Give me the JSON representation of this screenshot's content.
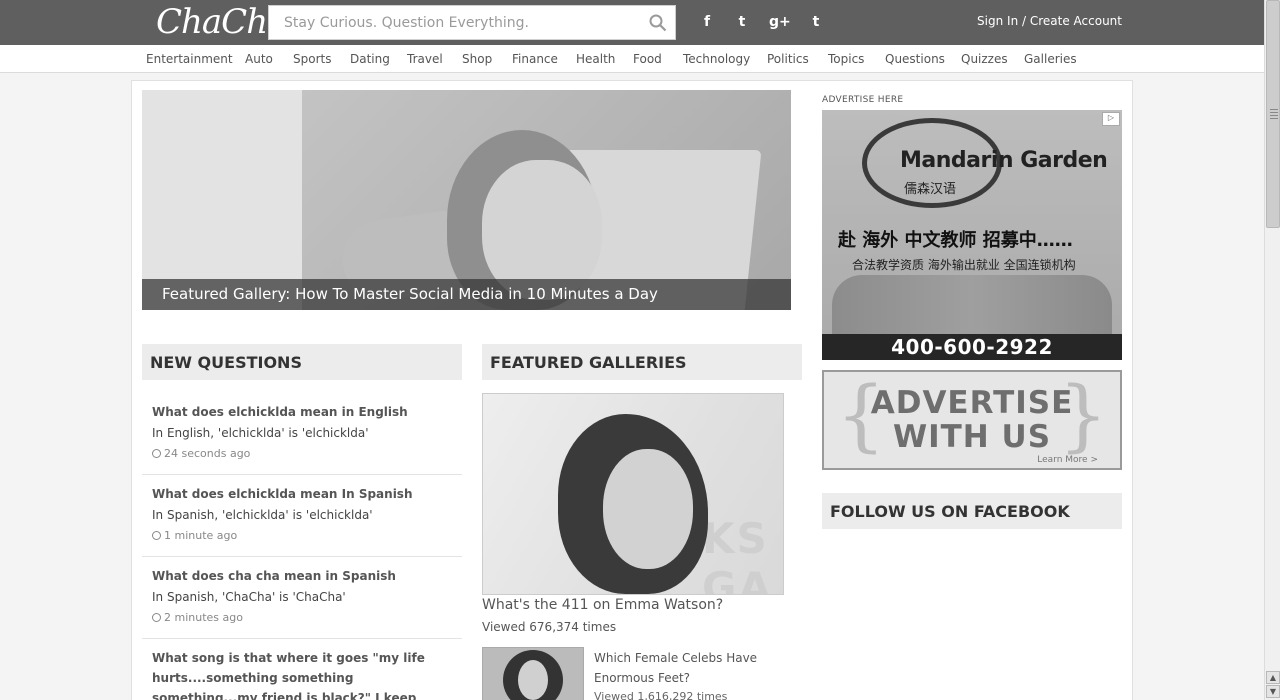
{
  "header": {
    "logo_text": "ChaCha",
    "search_placeholder": "Stay Curious. Question Everything.",
    "social_icons": [
      "facebook-icon",
      "twitter-icon",
      "google-plus-icon",
      "tumblr-icon"
    ],
    "social_glyphs": [
      "f",
      "t",
      "g+",
      "t"
    ],
    "signin_label": "Sign In / Create Account"
  },
  "nav": {
    "items": [
      "Entertainment",
      "Auto",
      "Sports",
      "Dating",
      "Travel",
      "Shop",
      "Finance",
      "Health",
      "Food",
      "Technology",
      "Politics",
      "Topics",
      "Questions",
      "Quizzes",
      "Galleries"
    ]
  },
  "hero": {
    "caption": "Featured Gallery: How To Master Social Media in 10 Minutes a Day"
  },
  "new_questions": {
    "heading": "NEW QUESTIONS",
    "items": [
      {
        "title": "What does elchicklda mean in English",
        "answer": "In English, 'elchicklda' is 'elchicklda'",
        "time": "24 seconds ago"
      },
      {
        "title": "What does elchicklda mean In Spanish",
        "answer": "In Spanish, 'elchicklda' is 'elchicklda'",
        "time": "1 minute ago"
      },
      {
        "title": "What does cha cha mean in Spanish",
        "answer": "In Spanish, 'ChaCha' is 'ChaCha'",
        "time": "2 minutes ago"
      },
      {
        "title": "What song is that where it goes \"my life hurts....something something something...my friend is black?\" I keep hearing people saying",
        "answer": "",
        "time": ""
      }
    ]
  },
  "featured_galleries": {
    "heading": "FEATURED GALLERIES",
    "items": [
      {
        "title": "What's the 411 on Emma Watson?",
        "views": "Viewed 676,374 times"
      },
      {
        "title": "Which Female Celebs Have Enormous Feet?",
        "views": "Viewed 1,616,292 times"
      }
    ]
  },
  "sidebar": {
    "advertise_label": "ADVERTISE HERE",
    "ad1": {
      "brand": "Mandarin Garden",
      "cn_brand": "儒森汉语",
      "cn_headline": "赴 海外  中文教师  招募中……",
      "cn_sub": "合法教学资质   海外输出就业   全国连锁机构",
      "phone": "400-600-2922"
    },
    "ad2": {
      "line1": "ADVERTISE",
      "line2": "WITH US",
      "more": "Learn More >"
    },
    "facebook_heading": "FOLLOW US ON FACEBOOK"
  }
}
